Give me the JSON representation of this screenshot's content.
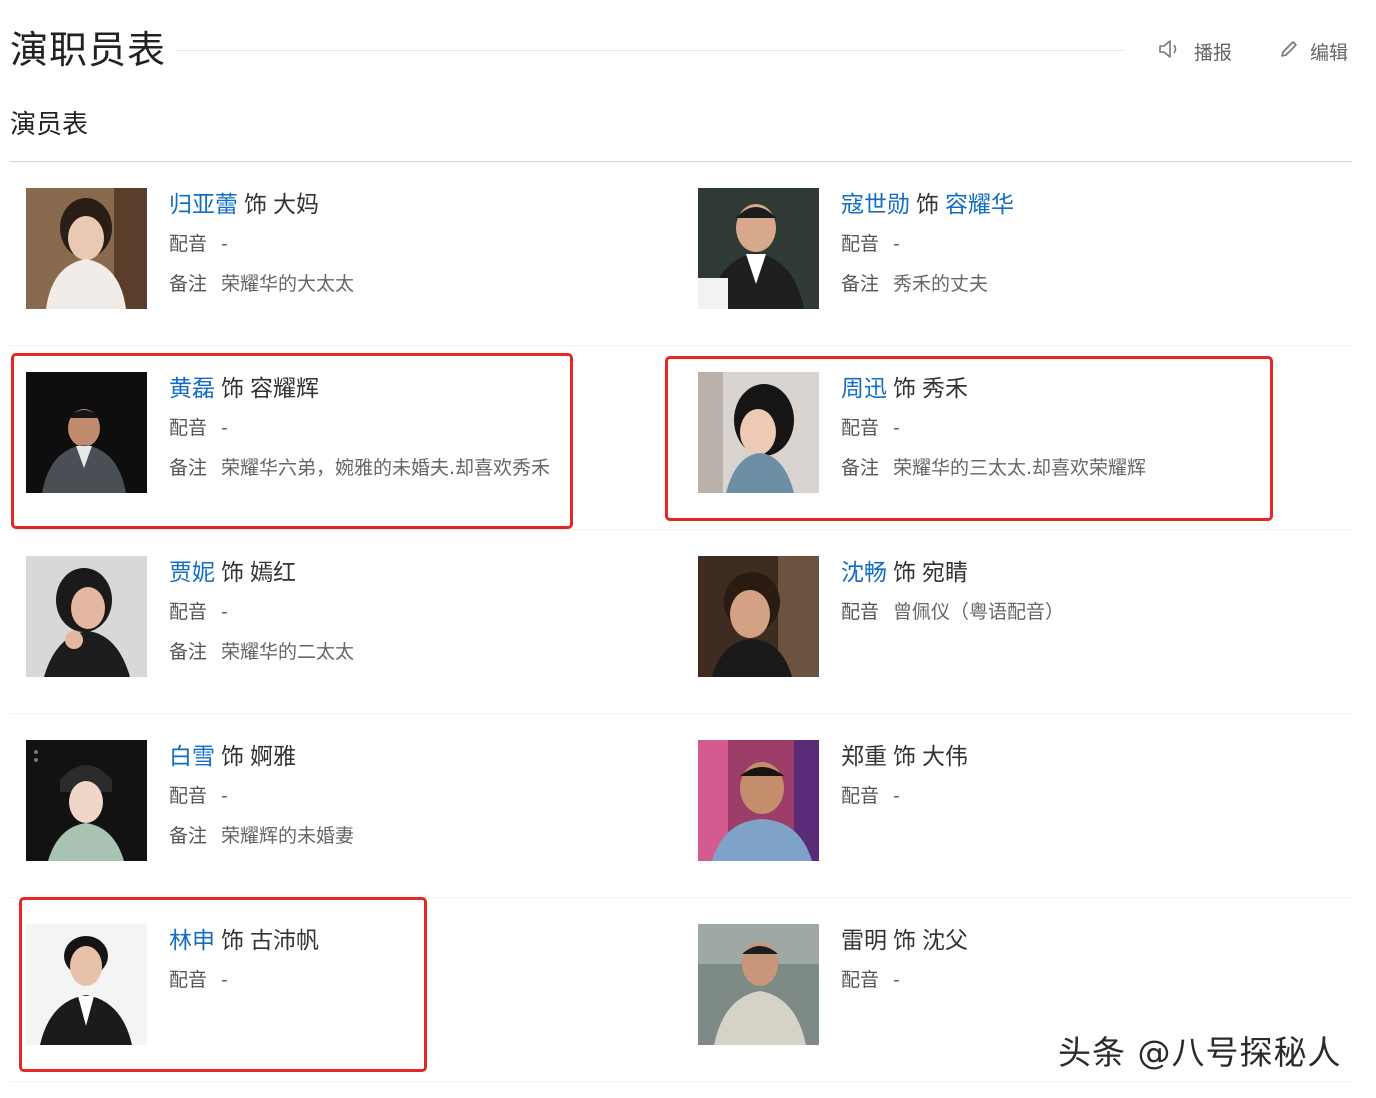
{
  "header": {
    "title": "演职员表",
    "report_label": "播报",
    "edit_label": "编辑"
  },
  "section": {
    "subtitle": "演员表"
  },
  "labels": {
    "shi": "饰",
    "dub": "配音",
    "note": "备注"
  },
  "cast": [
    {
      "actor": "归亚蕾",
      "role": "大妈",
      "dub": "-",
      "note": "荣耀华的大太太",
      "actor_link": true,
      "role_link": false
    },
    {
      "actor": "寇世勋",
      "role": "容耀华",
      "dub": "-",
      "note": "秀禾的丈夫",
      "actor_link": true,
      "role_link": true
    },
    {
      "actor": "黄磊",
      "role": "容耀辉",
      "dub": "-",
      "note": "荣耀华六弟，婉雅的未婚夫.却喜欢秀禾",
      "actor_link": true,
      "role_link": false
    },
    {
      "actor": "周迅",
      "role": "秀禾",
      "dub": "-",
      "note": "荣耀华的三太太.却喜欢荣耀辉",
      "actor_link": true,
      "role_link": false
    },
    {
      "actor": "贾妮",
      "role": "嫣红",
      "dub": "-",
      "note": "荣耀华的二太太",
      "actor_link": true,
      "role_link": false
    },
    {
      "actor": "沈畅",
      "role": "宛睛",
      "dub": "曾佩仪（粤语配音）",
      "note": "",
      "actor_link": true,
      "role_link": false
    },
    {
      "actor": "白雪",
      "role": "婀雅",
      "dub": "-",
      "note": "荣耀辉的未婚妻",
      "actor_link": true,
      "role_link": false
    },
    {
      "actor": "郑重",
      "role": "大伟",
      "dub": "-",
      "note": "",
      "actor_link": false,
      "role_link": false
    },
    {
      "actor": "林申",
      "role": "古沛帆",
      "dub": "-",
      "note": "",
      "actor_link": true,
      "role_link": false
    },
    {
      "actor": "雷明",
      "role": "沈父",
      "dub": "-",
      "note": "",
      "actor_link": false,
      "role_link": false
    }
  ],
  "highlights": [
    "黄磊",
    "周迅",
    "林申"
  ],
  "watermark": "头条 @八号探秘人",
  "colors": {
    "link": "#136ec2",
    "highlight": "#e52626"
  }
}
